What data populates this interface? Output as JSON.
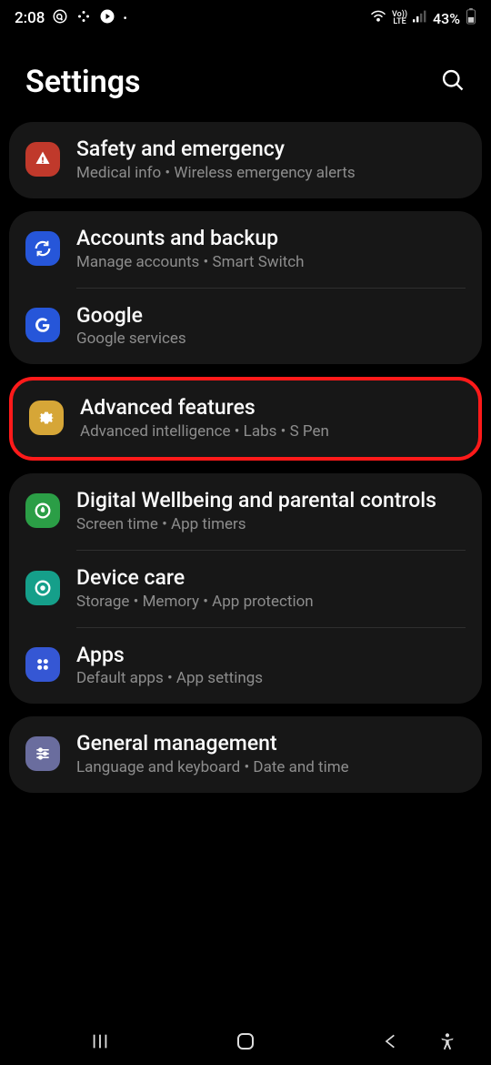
{
  "status": {
    "time": "2:08",
    "network_label": "LTE",
    "volte_label": "Vo))",
    "battery_percent": "43%"
  },
  "header": {
    "title": "Settings"
  },
  "groups": [
    {
      "items": [
        {
          "title": "Safety and emergency",
          "subtitle": "Medical info  •  Wireless emergency alerts"
        }
      ]
    },
    {
      "items": [
        {
          "title": "Accounts and backup",
          "subtitle": "Manage accounts  •  Smart Switch"
        },
        {
          "title": "Google",
          "subtitle": "Google services"
        }
      ]
    },
    {
      "highlighted": true,
      "items": [
        {
          "title": "Advanced features",
          "subtitle": "Advanced intelligence  •  Labs  •  S Pen"
        }
      ]
    },
    {
      "items": [
        {
          "title": "Digital Wellbeing and parental controls",
          "subtitle": "Screen time  •  App timers"
        },
        {
          "title": "Device care",
          "subtitle": "Storage  •  Memory  •  App protection"
        },
        {
          "title": "Apps",
          "subtitle": "Default apps  •  App settings"
        }
      ]
    },
    {
      "items": [
        {
          "title": "General management",
          "subtitle": "Language and keyboard  •  Date and time"
        }
      ]
    }
  ],
  "colors": {
    "emergency": "#c0392b",
    "accounts": "#2656d9",
    "google": "#2656d9",
    "advanced": "#d6a637",
    "wellbeing": "#2b9e46",
    "devicecare": "#159f8a",
    "apps": "#3557d4",
    "general": "#6a6d9e"
  }
}
